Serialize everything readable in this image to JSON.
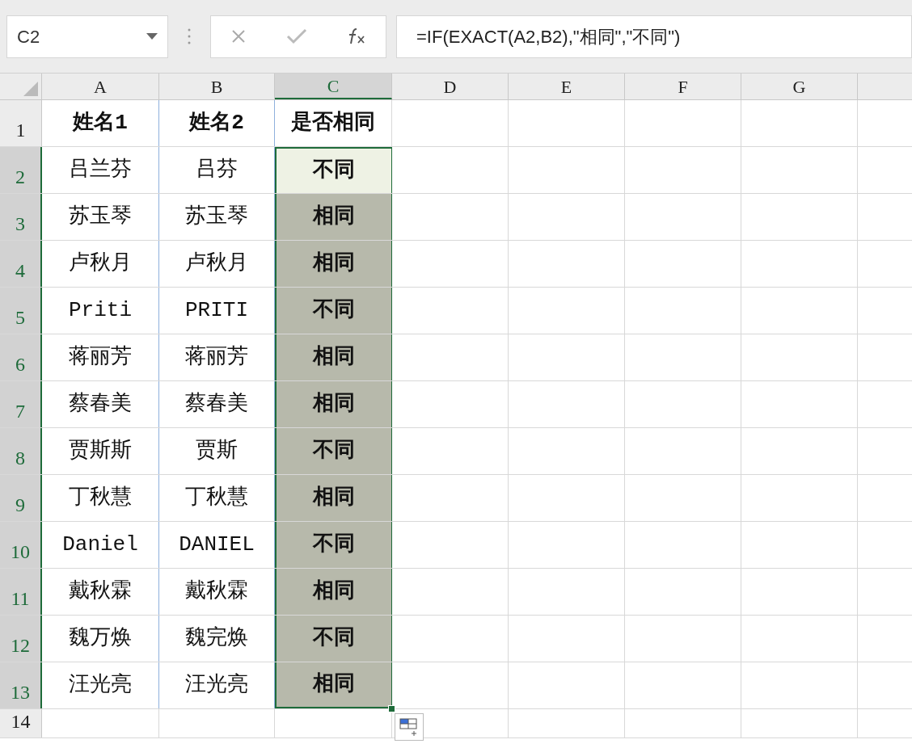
{
  "name_box": {
    "value": "C2"
  },
  "formula_bar": {
    "value": "=IF(EXACT(A2,B2),\"相同\",\"不同\")"
  },
  "columns": [
    {
      "label": "A",
      "selected": false
    },
    {
      "label": "B",
      "selected": false
    },
    {
      "label": "C",
      "selected": true
    },
    {
      "label": "D",
      "selected": false
    },
    {
      "label": "E",
      "selected": false
    },
    {
      "label": "F",
      "selected": false
    },
    {
      "label": "G",
      "selected": false
    }
  ],
  "rows": [
    {
      "number": "1",
      "selected": false,
      "active": false,
      "cells": [
        "姓名1",
        "姓名2",
        "是否相同"
      ]
    },
    {
      "number": "2",
      "selected": true,
      "active": true,
      "cells": [
        "吕兰芬",
        "吕芬",
        "不同"
      ]
    },
    {
      "number": "3",
      "selected": true,
      "active": false,
      "cells": [
        "苏玉琴",
        "苏玉琴",
        "相同"
      ]
    },
    {
      "number": "4",
      "selected": true,
      "active": false,
      "cells": [
        "卢秋月",
        "卢秋月",
        "相同"
      ]
    },
    {
      "number": "5",
      "selected": true,
      "active": false,
      "cells": [
        "Priti",
        "PRITI",
        "不同"
      ]
    },
    {
      "number": "6",
      "selected": true,
      "active": false,
      "cells": [
        "蒋丽芳",
        "蒋丽芳",
        "相同"
      ]
    },
    {
      "number": "7",
      "selected": true,
      "active": false,
      "cells": [
        "蔡春美",
        "蔡春美",
        "相同"
      ]
    },
    {
      "number": "8",
      "selected": true,
      "active": false,
      "cells": [
        "贾斯斯",
        "贾斯",
        "不同"
      ]
    },
    {
      "number": "9",
      "selected": true,
      "active": false,
      "cells": [
        "丁秋慧",
        "丁秋慧",
        "相同"
      ]
    },
    {
      "number": "10",
      "selected": true,
      "active": false,
      "cells": [
        "Daniel",
        "DANIEL",
        "不同"
      ]
    },
    {
      "number": "11",
      "selected": true,
      "active": false,
      "cells": [
        "戴秋霖",
        "戴秋霖",
        "相同"
      ]
    },
    {
      "number": "12",
      "selected": true,
      "active": false,
      "cells": [
        "魏万焕",
        "魏完焕",
        "不同"
      ]
    },
    {
      "number": "13",
      "selected": true,
      "active": false,
      "cells": [
        "汪光亮",
        "汪光亮",
        "相同"
      ]
    },
    {
      "number": "14",
      "selected": false,
      "active": false,
      "cells": []
    }
  ]
}
